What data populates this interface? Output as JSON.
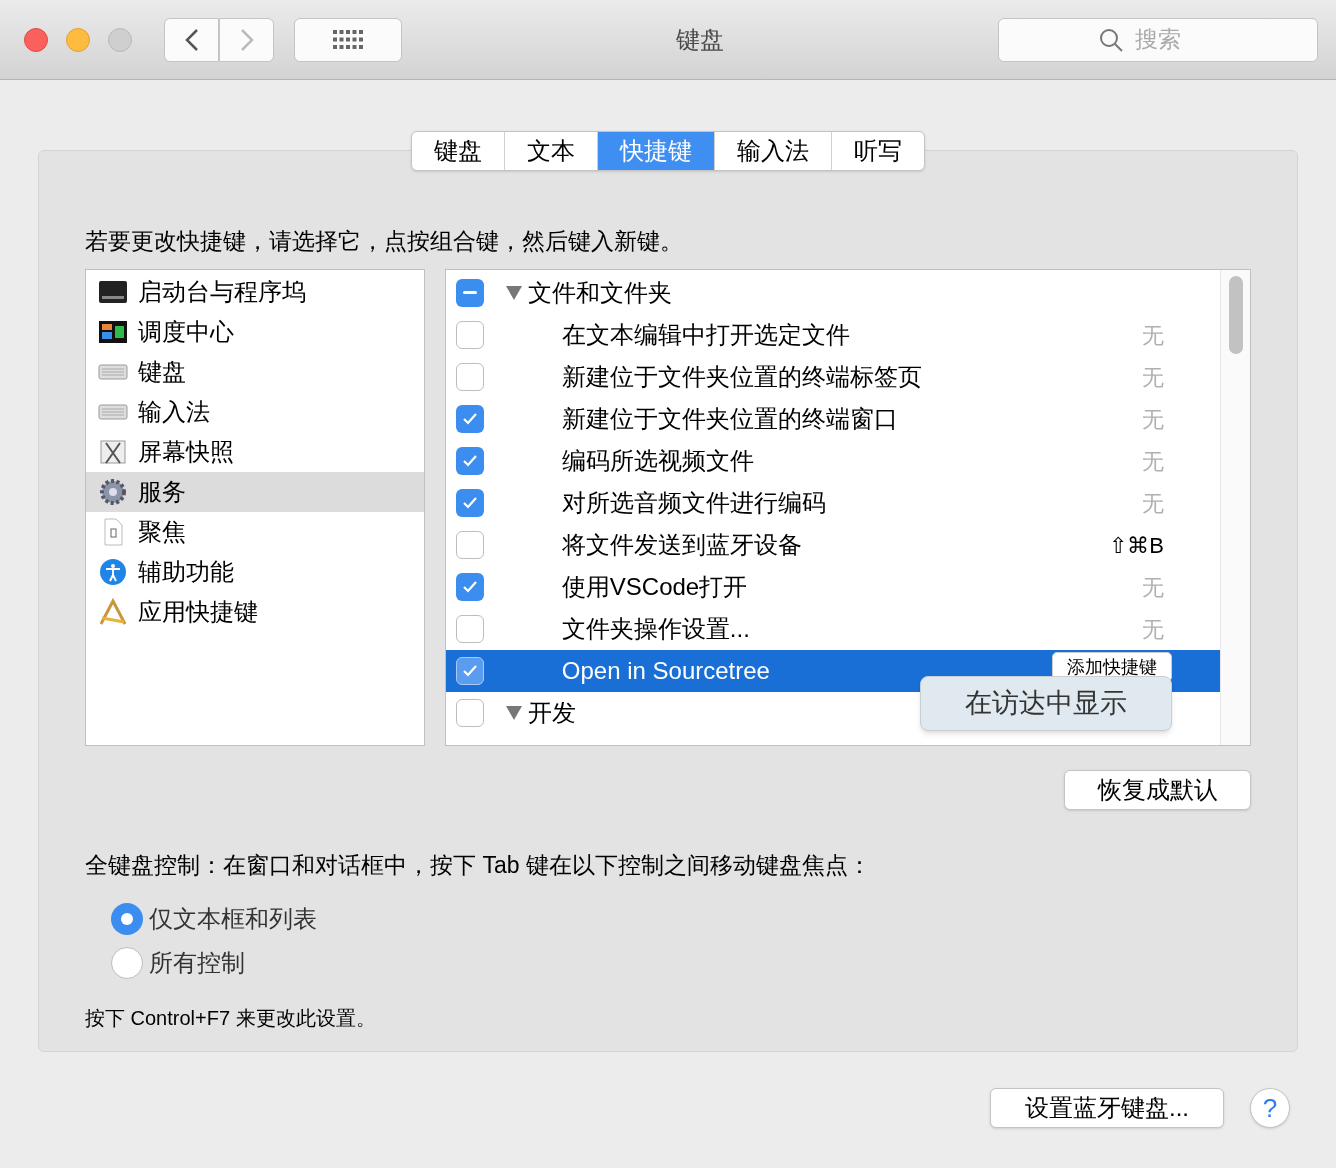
{
  "window": {
    "title": "键盘",
    "search_placeholder": "搜索"
  },
  "tabs": [
    {
      "label": "键盘",
      "selected": false
    },
    {
      "label": "文本",
      "selected": false
    },
    {
      "label": "快捷键",
      "selected": true
    },
    {
      "label": "输入法",
      "selected": false
    },
    {
      "label": "听写",
      "selected": false
    }
  ],
  "instruction": "若要更改快捷键，请选择它，点按组合键，然后键入新键。",
  "categories": [
    {
      "label": "启动台与程序坞",
      "selected": false
    },
    {
      "label": "调度中心",
      "selected": false
    },
    {
      "label": "键盘",
      "selected": false
    },
    {
      "label": "输入法",
      "selected": false
    },
    {
      "label": "屏幕快照",
      "selected": false
    },
    {
      "label": "服务",
      "selected": true
    },
    {
      "label": "聚焦",
      "selected": false
    },
    {
      "label": "辅助功能",
      "selected": false
    },
    {
      "label": "应用快捷键",
      "selected": false
    }
  ],
  "shortcuts": [
    {
      "kind": "group",
      "label": "文件和文件夹",
      "checked": true,
      "mixed": true,
      "expanded": true,
      "selected": false
    },
    {
      "kind": "item",
      "label": "在文本编辑中打开选定文件",
      "checked": false,
      "shortcut": "无",
      "selected": false
    },
    {
      "kind": "item",
      "label": "新建位于文件夹位置的终端标签页",
      "checked": false,
      "shortcut": "无",
      "selected": false
    },
    {
      "kind": "item",
      "label": "新建位于文件夹位置的终端窗口",
      "checked": true,
      "shortcut": "无",
      "selected": false
    },
    {
      "kind": "item",
      "label": "编码所选视频文件",
      "checked": true,
      "shortcut": "无",
      "selected": false
    },
    {
      "kind": "item",
      "label": "对所选音频文件进行编码",
      "checked": true,
      "shortcut": "无",
      "selected": false
    },
    {
      "kind": "item",
      "label": "将文件发送到蓝牙设备",
      "checked": false,
      "shortcut": "⇧⌘B",
      "selected": false
    },
    {
      "kind": "item",
      "label": "使用VSCode打开",
      "checked": true,
      "shortcut": "无",
      "selected": false
    },
    {
      "kind": "item",
      "label": "文件夹操作设置...",
      "checked": false,
      "shortcut": "无",
      "selected": false
    },
    {
      "kind": "item",
      "label": "Open in Sourcetree",
      "checked": true,
      "button": "添加快捷键",
      "selected": true
    },
    {
      "kind": "group",
      "label": "开发",
      "checked": false,
      "mixed": false,
      "expanded": true,
      "selected": false
    }
  ],
  "tooltip": "在访达中显示",
  "restore_button": "恢复成默认",
  "keyboard_control": {
    "label": "全键盘控制：在窗口和对话框中，按下 Tab 键在以下控制之间移动键盘焦点：",
    "options": [
      {
        "label": "仅文本框和列表",
        "selected": true
      },
      {
        "label": "所有控制",
        "selected": false
      }
    ],
    "hint": "按下 Control+F7 来更改此设置。"
  },
  "bluetooth_button": "设置蓝牙键盘...",
  "help_button": "?"
}
